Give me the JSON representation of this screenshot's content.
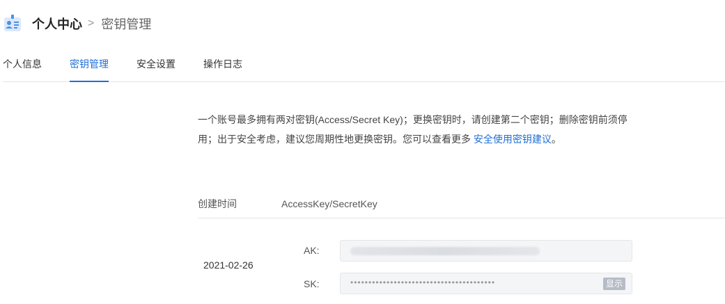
{
  "header": {
    "icon": "user-card-icon",
    "title": "个人中心",
    "separator": ">",
    "current": "密钥管理"
  },
  "tabs": [
    {
      "label": "个人信息",
      "active": false
    },
    {
      "label": "密钥管理",
      "active": true
    },
    {
      "label": "安全设置",
      "active": false
    },
    {
      "label": "操作日志",
      "active": false
    }
  ],
  "notice": {
    "text": "一个账号最多拥有两对密钥(Access/Secret Key)；更换密钥时，请创建第二个密钥；删除密钥前须停用；出于安全考虑，建议您周期性地更换密钥。您可以查看更多 ",
    "link": "安全使用密钥建议",
    "end": "。"
  },
  "table": {
    "columns": [
      "创建时间",
      "AccessKey/SecretKey"
    ],
    "rows": [
      {
        "created": "2021-02-26",
        "ak_label": "AK:",
        "sk_label": "SK:",
        "sk_masked": "••••••••••••••••••••••••••••••••••••••••",
        "show_label": "显示"
      }
    ]
  },
  "colors": {
    "accent": "#1d6fd8",
    "icon": "#4a90e2"
  }
}
